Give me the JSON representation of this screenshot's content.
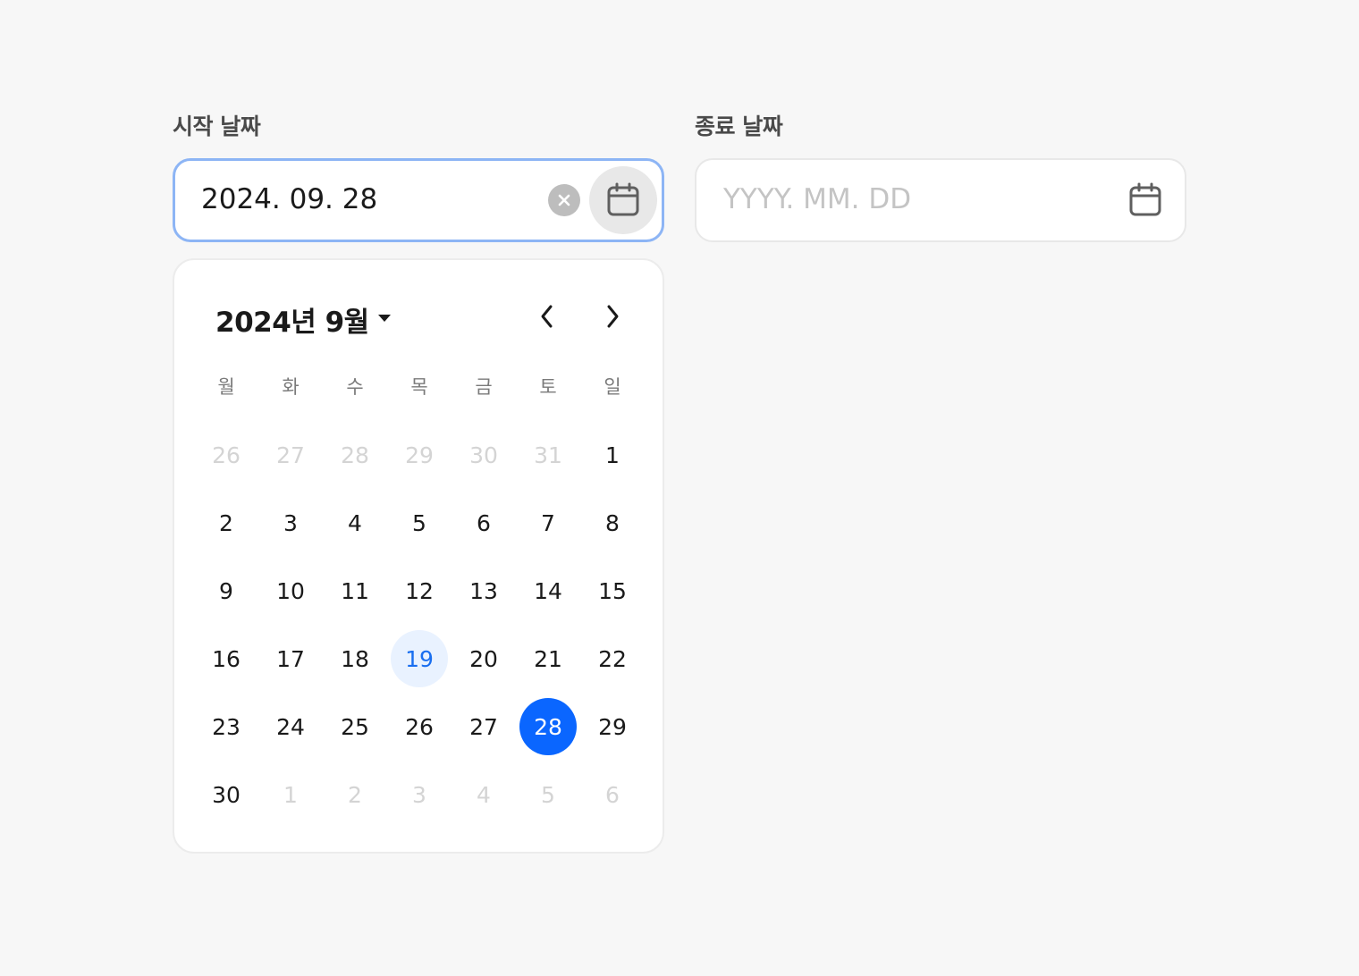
{
  "start": {
    "label": "시작 날짜",
    "value": "2024. 09. 28",
    "clear_icon": "close-circle-icon",
    "calendar_icon": "calendar-icon"
  },
  "end": {
    "label": "종료 날짜",
    "placeholder": "YYYY. MM. DD",
    "calendar_icon": "calendar-icon"
  },
  "calendar": {
    "month_title": "2024년 9월",
    "caret_icon": "caret-down-icon",
    "prev_icon": "chevron-left-icon",
    "next_icon": "chevron-right-icon",
    "weekdays": [
      "월",
      "화",
      "수",
      "목",
      "금",
      "토",
      "일"
    ],
    "weeks": [
      [
        {
          "label": "26",
          "state": "muted"
        },
        {
          "label": "27",
          "state": "muted"
        },
        {
          "label": "28",
          "state": "muted"
        },
        {
          "label": "29",
          "state": "muted"
        },
        {
          "label": "30",
          "state": "muted"
        },
        {
          "label": "31",
          "state": "muted"
        },
        {
          "label": "1",
          "state": "normal"
        }
      ],
      [
        {
          "label": "2",
          "state": "normal"
        },
        {
          "label": "3",
          "state": "normal"
        },
        {
          "label": "4",
          "state": "normal"
        },
        {
          "label": "5",
          "state": "normal"
        },
        {
          "label": "6",
          "state": "normal"
        },
        {
          "label": "7",
          "state": "normal"
        },
        {
          "label": "8",
          "state": "normal"
        }
      ],
      [
        {
          "label": "9",
          "state": "normal"
        },
        {
          "label": "10",
          "state": "normal"
        },
        {
          "label": "11",
          "state": "normal"
        },
        {
          "label": "12",
          "state": "normal"
        },
        {
          "label": "13",
          "state": "normal"
        },
        {
          "label": "14",
          "state": "normal"
        },
        {
          "label": "15",
          "state": "normal"
        }
      ],
      [
        {
          "label": "16",
          "state": "normal"
        },
        {
          "label": "17",
          "state": "normal"
        },
        {
          "label": "18",
          "state": "normal"
        },
        {
          "label": "19",
          "state": "today"
        },
        {
          "label": "20",
          "state": "normal"
        },
        {
          "label": "21",
          "state": "normal"
        },
        {
          "label": "22",
          "state": "normal"
        }
      ],
      [
        {
          "label": "23",
          "state": "normal"
        },
        {
          "label": "24",
          "state": "normal"
        },
        {
          "label": "25",
          "state": "normal"
        },
        {
          "label": "26",
          "state": "normal"
        },
        {
          "label": "27",
          "state": "normal"
        },
        {
          "label": "28",
          "state": "selected"
        },
        {
          "label": "29",
          "state": "normal"
        }
      ],
      [
        {
          "label": "30",
          "state": "normal"
        },
        {
          "label": "1",
          "state": "muted"
        },
        {
          "label": "2",
          "state": "muted"
        },
        {
          "label": "3",
          "state": "muted"
        },
        {
          "label": "4",
          "state": "muted"
        },
        {
          "label": "5",
          "state": "muted"
        },
        {
          "label": "6",
          "state": "muted"
        }
      ]
    ]
  },
  "colors": {
    "accent": "#0a66ff",
    "today_bg": "#e9f2ff",
    "focus_border": "#8db5f5",
    "muted_text": "#d4d4d4",
    "page_bg": "#f7f7f7"
  }
}
